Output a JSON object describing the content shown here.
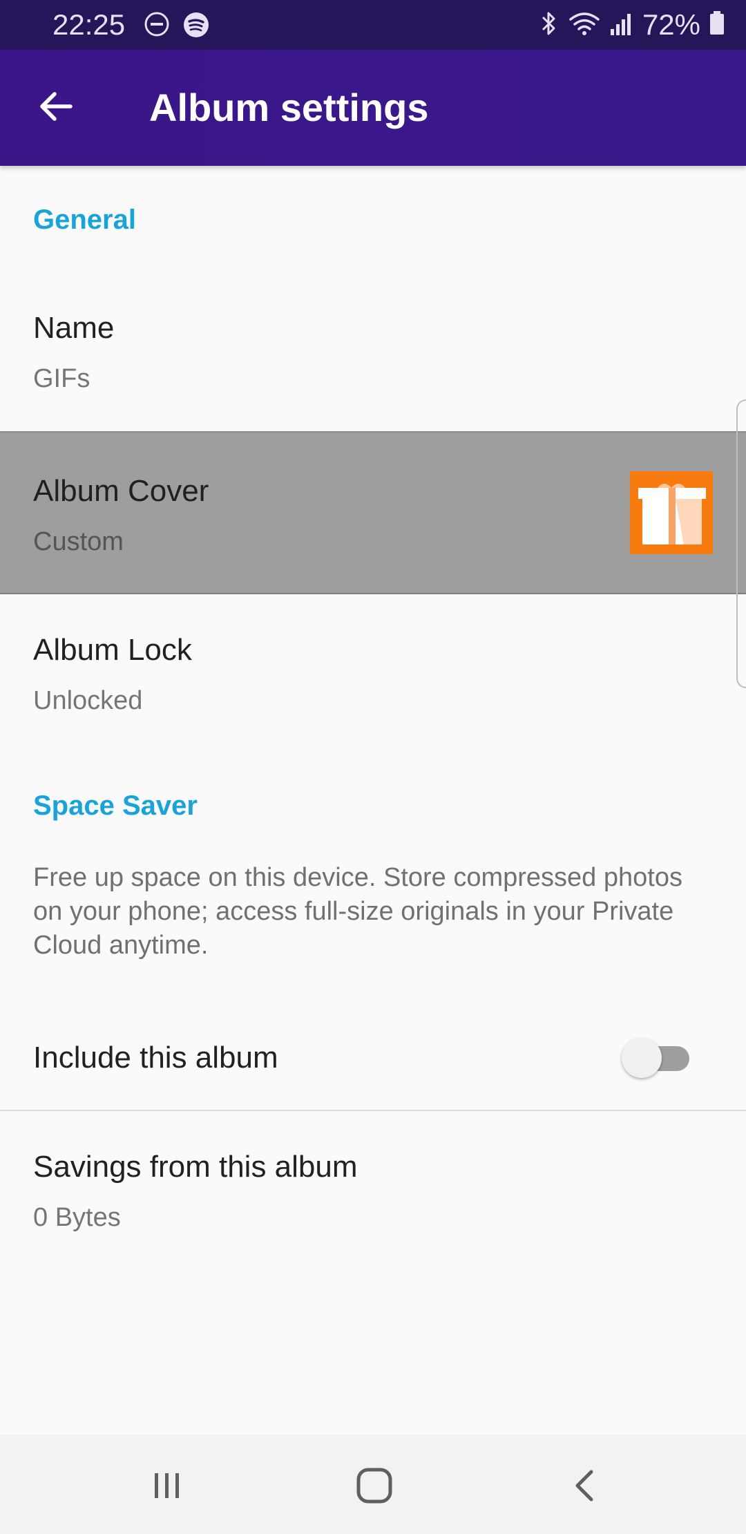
{
  "status_bar": {
    "time": "22:25",
    "battery": "72%",
    "left_icons": [
      "do-not-disturb-icon",
      "spotify-icon"
    ],
    "right_icons": [
      "bluetooth-icon",
      "wifi-icon",
      "signal-icon",
      "battery-icon"
    ]
  },
  "app_bar": {
    "title": "Album settings",
    "back_icon": "arrow-left-icon"
  },
  "sections": {
    "general": {
      "header": "General",
      "name": {
        "title": "Name",
        "value": "GIFs"
      },
      "album_cover": {
        "title": "Album Cover",
        "value": "Custom",
        "thumb_icon": "gift-icon"
      },
      "album_lock": {
        "title": "Album Lock",
        "value": "Unlocked"
      }
    },
    "space_saver": {
      "header": "Space Saver",
      "description": "Free up space on this device. Store compressed photos on your phone; access full-size originals in your Private Cloud anytime.",
      "include": {
        "title": "Include this album",
        "enabled": false
      },
      "savings": {
        "title": "Savings from this album",
        "value": "0 Bytes"
      }
    }
  },
  "nav_bar": {
    "icons": [
      "recent-apps-icon",
      "home-icon",
      "back-icon"
    ]
  },
  "colors": {
    "status_bar": "#261558",
    "app_bar": "#3c1689",
    "section_header": "#1aa3d9",
    "highlight_row": "#9e9e9e",
    "cover_thumb": "#f77b0f"
  }
}
